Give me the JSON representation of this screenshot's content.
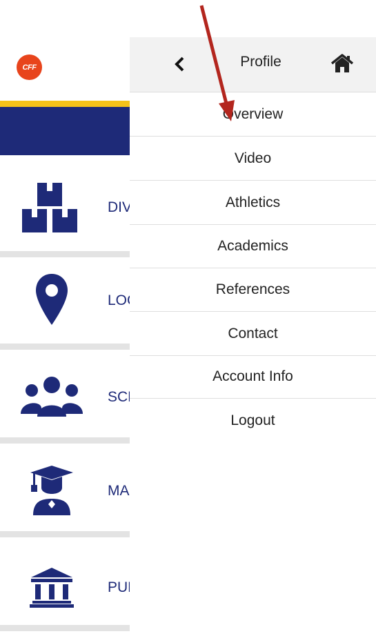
{
  "app": {
    "logo_text": "CFF",
    "menu_items": [
      {
        "label": "DIVISIONS",
        "icon": "boxes-icon"
      },
      {
        "label": "LOCATIONS",
        "icon": "map-pin-icon"
      },
      {
        "label": "SCHOOLS",
        "icon": "users-icon"
      },
      {
        "label": "MAJORS",
        "icon": "graduate-icon"
      },
      {
        "label": "PUBLIC",
        "icon": "institution-icon"
      }
    ]
  },
  "drawer": {
    "title": "Profile",
    "back_icon": "chevron-left-icon",
    "home_icon": "home-icon",
    "items": [
      "Overview",
      "Video",
      "Athletics",
      "Academics",
      "References",
      "Contact",
      "Account Info",
      "Logout"
    ]
  },
  "colors": {
    "brand_blue": "#1e2a78",
    "accent_yellow": "#f5c21a",
    "logo_red": "#e8441c",
    "arrow_red": "#b3261e"
  }
}
